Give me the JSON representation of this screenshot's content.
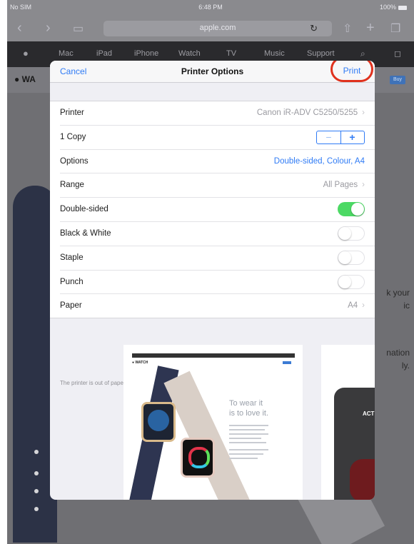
{
  "status_bar": {
    "carrier": "No SIM",
    "time": "6:48 PM",
    "battery": "100%"
  },
  "browser": {
    "url": "apple.com"
  },
  "apple_nav": {
    "items": [
      "Mac",
      "iPad",
      "iPhone",
      "Watch",
      "TV",
      "Music",
      "Support"
    ]
  },
  "apple_subnav": {
    "brand": "WA",
    "buy": "Buy"
  },
  "background": {
    "text_right_1": "k your",
    "text_right_2": "ic",
    "text_right_3": "nation",
    "text_right_4": "ly."
  },
  "dialog": {
    "cancel": "Cancel",
    "title": "Printer Options",
    "print": "Print",
    "rows": {
      "printer": {
        "label": "Printer",
        "value": "Canon iR-ADV C5250/5255"
      },
      "copies": {
        "label": "1 Copy",
        "minus": "−",
        "plus": "+"
      },
      "options": {
        "label": "Options",
        "value": "Double-sided, Colour, A4"
      },
      "range": {
        "label": "Range",
        "value": "All Pages"
      },
      "double_sided": {
        "label": "Double-sided",
        "on": true
      },
      "black_white": {
        "label": "Black & White",
        "on": false
      },
      "staple": {
        "label": "Staple",
        "on": false
      },
      "punch": {
        "label": "Punch",
        "on": false
      },
      "paper": {
        "label": "Paper",
        "value": "A4"
      }
    },
    "footnote": "The printer is out of paper.",
    "chevron": "›"
  },
  "preview": {
    "headline_1": "To wear it",
    "headline_2": "is to love it.",
    "page2_label": "ACT"
  },
  "colors": {
    "accent": "#2f7bf5",
    "toggle_on": "#4cd964",
    "highlight_circle": "#e0311d"
  }
}
